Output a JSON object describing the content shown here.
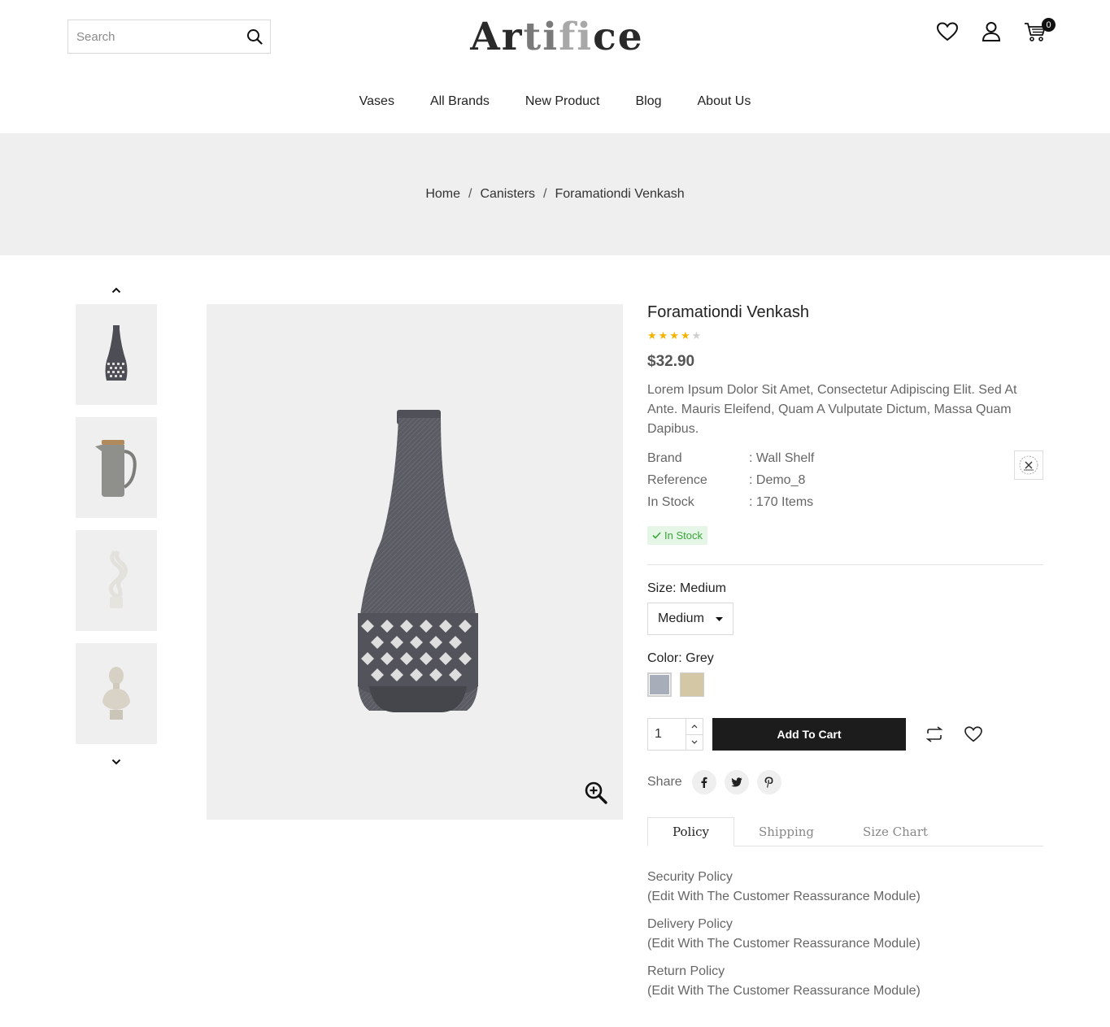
{
  "header": {
    "search_placeholder": "Search",
    "logo": {
      "part1": "Ar",
      "part2": "ti",
      "part3": "fi",
      "part4": "ce"
    },
    "cart_count": "0"
  },
  "nav": [
    "Vases",
    "All Brands",
    "New Product",
    "Blog",
    "About Us"
  ],
  "breadcrumb": {
    "home": "Home",
    "category": "Canisters",
    "current": "Foramationdi Venkash",
    "separator": "/"
  },
  "product": {
    "title": "Foramationdi Venkash",
    "rating": 4,
    "rating_max": 5,
    "price": "$32.90",
    "description": "Lorem Ipsum Dolor Sit Amet, Consectetur Adipiscing Elit. Sed At Ante. Mauris Eleifend, Quam A Vulputate Dictum, Massa Quam Dapibus.",
    "meta": [
      {
        "key": "Brand",
        "value": ": Wall Shelf"
      },
      {
        "key": "Reference",
        "value": ": Demo_8"
      },
      {
        "key": "In Stock",
        "value": ": 170 Items"
      }
    ],
    "stock_badge": "In Stock",
    "size_label": "Size: Medium",
    "size_value": "Medium",
    "color_label": "Color: Grey",
    "colors": [
      "#a7adb9",
      "#d4c7a6"
    ],
    "quantity": "1",
    "add_to_cart": "Add To Cart",
    "share_label": "Share"
  },
  "tabs": [
    "Policy",
    "Shipping",
    "Size Chart"
  ],
  "policies": [
    {
      "title": "Security Policy",
      "note": "(Edit With The Customer Reassurance Module)"
    },
    {
      "title": "Delivery Policy",
      "note": "(Edit With The Customer Reassurance Module)"
    },
    {
      "title": "Return Policy",
      "note": "(Edit With The Customer Reassurance Module)"
    }
  ]
}
